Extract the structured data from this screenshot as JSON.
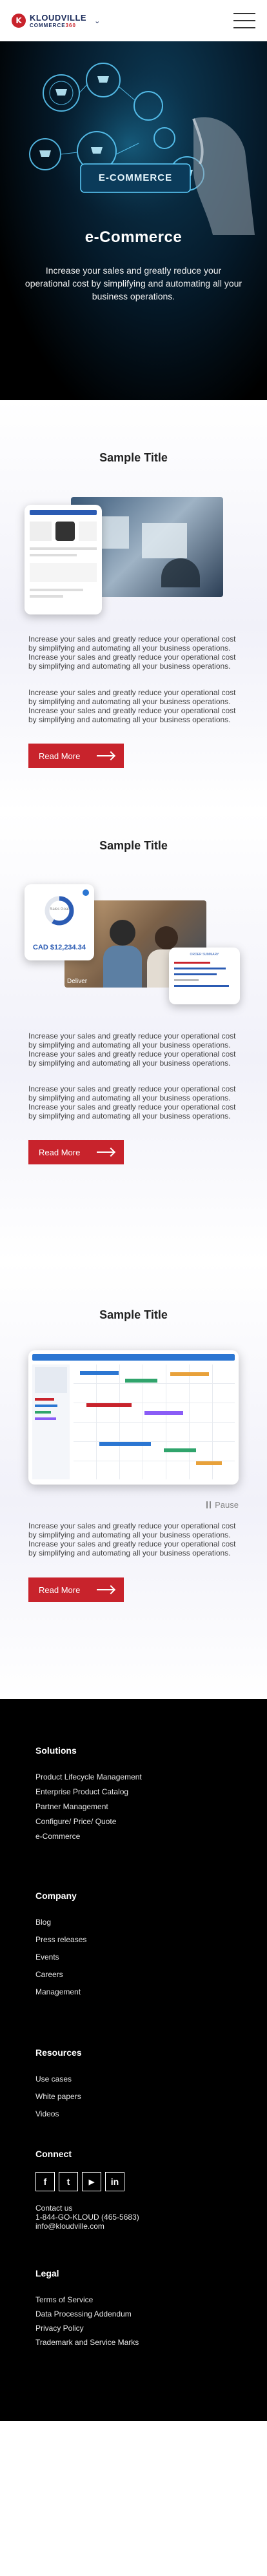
{
  "header": {
    "logo_mark": "K",
    "logo_name": "KLOUDVILLE",
    "logo_sub_prefix": "COMMERCE",
    "logo_sub_suffix": "360",
    "logo_chevron": "⌄"
  },
  "hero": {
    "banner_text": "E-COMMERCE",
    "title": "e-Commerce",
    "text": "Increase your sales and greatly reduce your operational cost by simplifying and automating all your business operations."
  },
  "sections": [
    {
      "title": "Sample Title",
      "para1": "Increase your sales and greatly reduce your operational cost by simplifying and automating all your business operations. Increase your sales and greatly reduce your operational cost by simplifying and automating all your business operations.",
      "para2": "Increase your sales and greatly reduce your operational cost by simplifying and automating all your business operations. Increase your sales and greatly reduce your operational cost by simplifying and automating all your business operations.",
      "button": "Read More"
    },
    {
      "title": "Sample Title",
      "card_amount": "CAD $12,234.34",
      "card_label": "Sales Goal",
      "photo_caption": "Deliver",
      "right_card_title": "ORDER SUMMARY",
      "para1": "Increase your sales and greatly reduce your operational cost by simplifying and automating all your business operations. Increase your sales and greatly reduce your operational cost by simplifying and automating all your business operations.",
      "para2": "Increase your sales and greatly reduce your operational cost by simplifying and automating all your business operations. Increase your sales and greatly reduce your operational cost by simplifying and automating all your business operations.",
      "button": "Read More"
    },
    {
      "title": "Sample Title",
      "pause": "Pause",
      "para1": "Increase your sales and greatly reduce your operational cost by simplifying and automating all your business operations. Increase your sales and greatly reduce your operational cost by simplifying and automating all your business operations.",
      "button": "Read More"
    }
  ],
  "footer": {
    "solutions": {
      "heading": "Solutions",
      "links": [
        "Product Lifecycle Management",
        "Enterprise Product Catalog",
        "Partner Management",
        "Configure/ Price/ Quote",
        "e-Commerce"
      ]
    },
    "company": {
      "heading": "Company",
      "links": [
        "Blog",
        "Press releases",
        "Events",
        "Careers",
        "Management"
      ]
    },
    "resources": {
      "heading": "Resources",
      "links": [
        "Use cases",
        "White papers",
        "Videos"
      ]
    },
    "connect": {
      "heading": "Connect",
      "social": [
        "f",
        "t",
        "▶",
        "in"
      ],
      "contact_label": "Contact us",
      "phone": "1-844-GO-KLOUD (465-5683)",
      "email": "info@kloudville.com"
    },
    "legal": {
      "heading": "Legal",
      "links": [
        "Terms of Service",
        "Data Processing Addendum",
        "Privacy Policy",
        "Trademark and Service Marks"
      ]
    }
  },
  "colors": {
    "brand_red": "#c8232c",
    "brand_navy": "#1a2a5a",
    "footer_bg": "#000000"
  }
}
